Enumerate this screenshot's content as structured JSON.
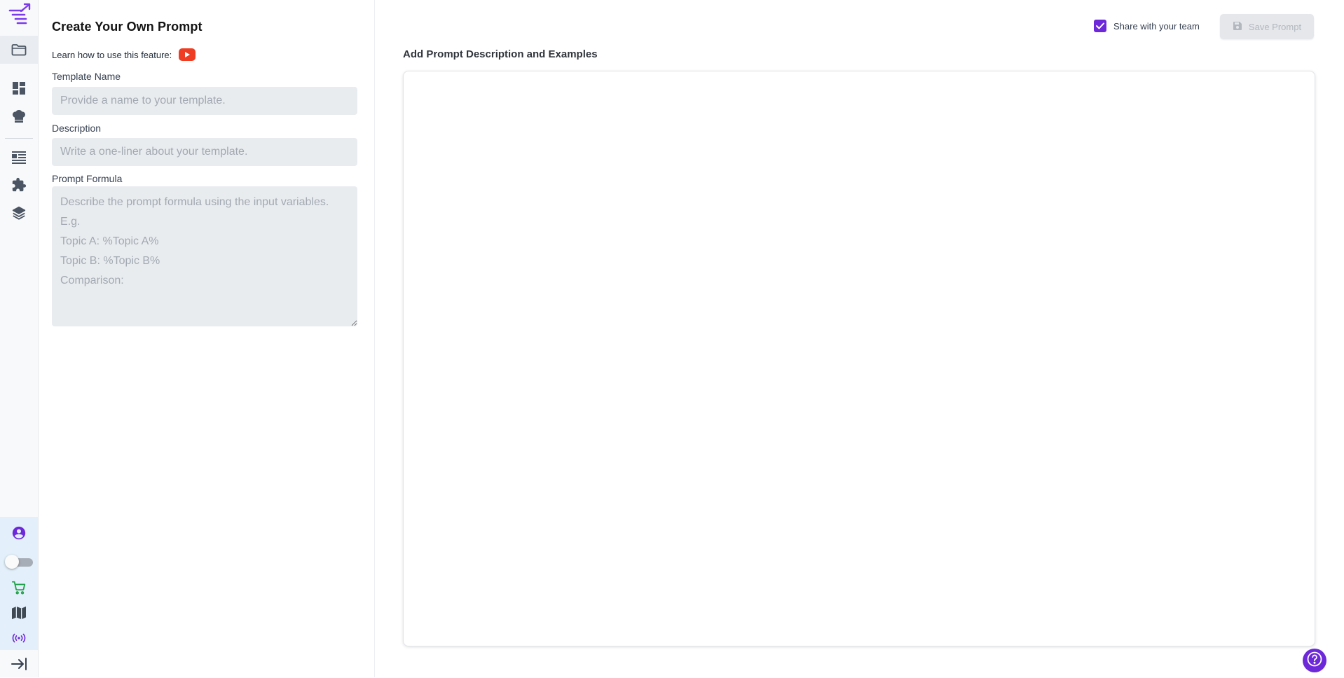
{
  "sidebar": {
    "logo_icon": "prompt-list-logo-icon",
    "nav_items": [
      {
        "icon": "folder-icon",
        "active": true
      },
      {
        "icon": "dashboard-icon"
      },
      {
        "icon": "chef-hat-icon"
      },
      {
        "icon": "list-view-icon"
      },
      {
        "icon": "puzzle-icon"
      },
      {
        "icon": "layers-icon"
      }
    ],
    "bottom_items": [
      {
        "icon": "account-circle-icon"
      },
      {
        "icon": "toggle-switch"
      },
      {
        "icon": "cart-icon"
      },
      {
        "icon": "map-icon"
      },
      {
        "icon": "broadcast-icon"
      },
      {
        "icon": "collapse-arrow-icon"
      }
    ],
    "toggle_on": false
  },
  "form": {
    "title": "Create Your Own Prompt",
    "learn_text": "Learn how to use this feature:",
    "template_name_label": "Template Name",
    "template_name_placeholder": "Provide a name to your template.",
    "template_name_value": "",
    "description_label": "Description",
    "description_placeholder": "Write a one-liner about your template.",
    "description_value": "",
    "formula_label": "Prompt Formula",
    "formula_placeholder": "Describe the prompt formula using the input variables. E.g.\nTopic A: %Topic A%\nTopic B: %Topic B%\nComparison:",
    "formula_value": ""
  },
  "main": {
    "share_label": "Share with your team",
    "share_checked": true,
    "save_label": "Save Prompt",
    "save_disabled": true,
    "editor_label": "Add Prompt Description and Examples",
    "editor_value": ""
  },
  "colors": {
    "accent": "#6d28d9",
    "youtube": "#ef3d23",
    "field_bg": "#e9ecef"
  }
}
